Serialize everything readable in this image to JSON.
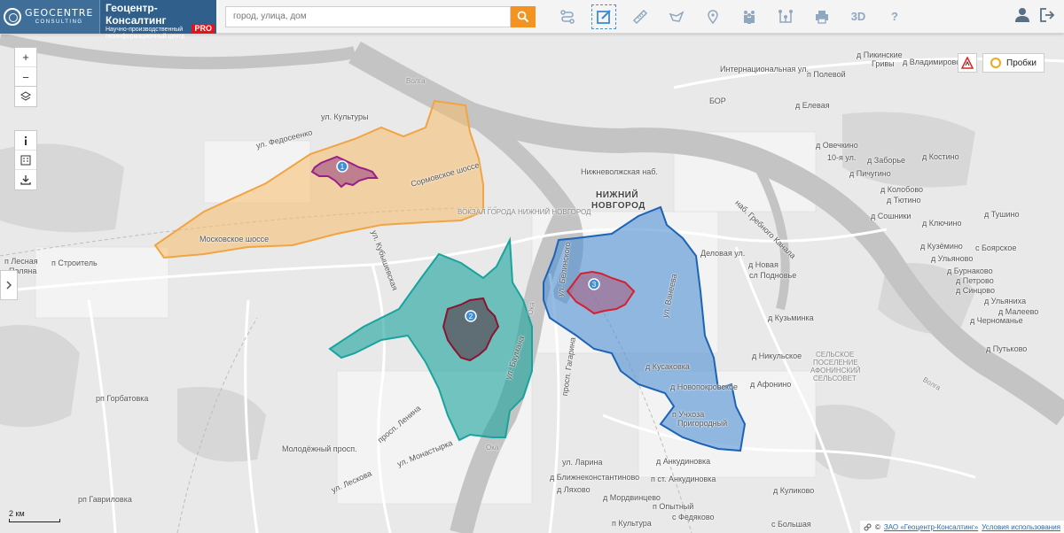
{
  "brand": {
    "logo_line1": "GEOCENTRE",
    "logo_line2": "CONSULTING",
    "name": "Геоцентр-Консалтинг",
    "subtitle": "Научно-производственный геоинформационный центр",
    "pro": "PRO"
  },
  "search": {
    "placeholder": "город, улица, дом"
  },
  "tools": [
    "route-icon",
    "edit-icon",
    "ruler-icon",
    "area-icon",
    "marker-icon",
    "people-icon",
    "network-icon",
    "print-icon"
  ],
  "tool_3d": "3D",
  "tool_help": "?",
  "traffic": {
    "label": "Пробки"
  },
  "scale": {
    "label": "2 км"
  },
  "copyright": {
    "owner": "ЗАО «Геоцентр-Консалтинг»",
    "terms": "Условия использования"
  },
  "markers": [
    "1",
    "2",
    "3"
  ],
  "labels": {
    "nizhny": "НИЖНИЙ",
    "novgorod": "НОВГОРОД",
    "pikinskie": "д Пикинские",
    "grivy": "Гривы",
    "vladimirovo": "д Владимирово",
    "polevoy": "п Полевой",
    "internat": "Интернациональная ул.",
    "bor": "БОР",
    "eleva": "д Елевая",
    "ovechkino": "д Овечкино",
    "ul10": "10-я ул.",
    "zaborye": "д Заборье",
    "kostino": "д Костино",
    "pichugino": "д Пичугино",
    "kolobovo": "д Колобово",
    "tyutino": "д Тютино",
    "klyuchino": "д Ключино",
    "soshniki": "д Сошники",
    "tushino": "д Тушино",
    "boyarskoe": "с Боярское",
    "kuzemino": "д Кузёмино",
    "ulyanovo": "д Ульяново",
    "burnakovo": "д Бурнаково",
    "petrovo": "д Петрово",
    "sinkovo": "д Синцово",
    "ulyaniha": "д Ульяниха",
    "maleevo": "д Малеево",
    "chernomanie": "д Черноманье",
    "putkovo": "д Путьково",
    "selskoe1": "СЕЛЬСКОЕ",
    "selskoe2": "ПОСЕЛЕНИЕ",
    "selskoe3": "АФОНИНСКИЙ",
    "selskoe4": "СЕЛЬСОВЕТ",
    "kultury": "ул. Культуры",
    "fedoseenko": "ул. Федосеенко",
    "sormovskoe": "Сормовское шоссе",
    "moskovskoe": "Московское шоссе",
    "vokzal": "ВОКЗАЛ ГОРОДА НИЖНИЙ НОВГОРОД",
    "kuybyshev": "ул. Кубышевская",
    "nizhnevolzh": "Нижневолжская наб.",
    "grebnoy": "наб. Гребного Канала",
    "delovaya": "Деловая ул.",
    "novaya": "д Новая",
    "podnovye": "сл Подновье",
    "kuzminka": "д Кузьминка",
    "vaneeva": "ул. Ванеева",
    "belinskogo": "ул. Белинского",
    "gagarina": "просп. Гагарина",
    "bauman": "ул. Баумана",
    "lenina": "просп. Ленина",
    "molodezh": "Молодёжный просп.",
    "monastyrka": "ул. Монастырка",
    "leskova": "ул. Лескова",
    "larina": "ул. Ларина",
    "ankud": "д Анкудиновка",
    "blizhne": "д Ближнеконстантиново",
    "pstankud": "п ст. Анкудиновка",
    "lyahovo": "д Ляхово",
    "mordvinc": "д Мордвинцево",
    "opytny": "п Опытный",
    "fedyakovo": "с Федяково",
    "kultura": "п Культура",
    "bolshaya": "с Большая",
    "kulikovo": "д Куликово",
    "nikulskoe": "д Никульское",
    "afonino": "д Афонино",
    "novopokr": "д Новопокровское",
    "uchkoza": "п Учхоза",
    "prigorod": "Пригородный",
    "kusaka": "д Кусаковка",
    "leskovo": "п Лесная",
    "poliana": "Поляна",
    "stroitel": "п Строитель",
    "gorbatov": "рп Горбатовка",
    "gavrilovka": "рп Гавриловка",
    "volga1": "Волга",
    "volga2": "Волга",
    "oka1": "Ока",
    "oka2": "Ока"
  }
}
